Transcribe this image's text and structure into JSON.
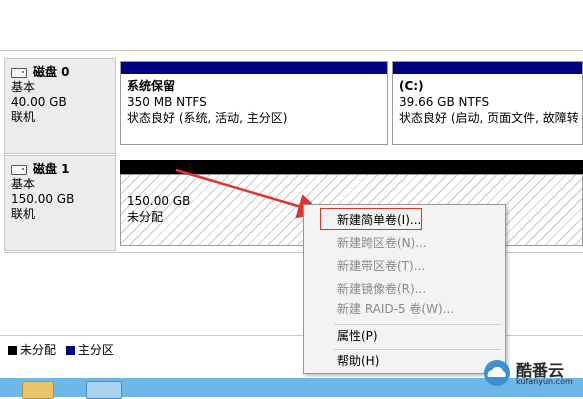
{
  "disks": [
    {
      "name": "磁盘 0",
      "type": "基本",
      "size": "40.00 GB",
      "status": "联机",
      "partitions": [
        {
          "name": "系统保留",
          "size": "350 MB NTFS",
          "status": "状态良好 (系统, 活动, 主分区)"
        },
        {
          "name": "(C:)",
          "size": "39.66 GB NTFS",
          "status": "状态良好 (启动, 页面文件, 故障转"
        }
      ]
    },
    {
      "name": "磁盘 1",
      "type": "基本",
      "size": "150.00 GB",
      "status": "联机",
      "partitions": [
        {
          "size": "150.00 GB",
          "status": "未分配"
        }
      ]
    }
  ],
  "legend": [
    {
      "label": "未分配",
      "color": "#000000"
    },
    {
      "label": "主分区",
      "color": "#000080"
    }
  ],
  "context_menu": {
    "items": [
      {
        "label": "新建简单卷(I)...",
        "enabled": true
      },
      {
        "label": "新建跨区卷(N)...",
        "enabled": false
      },
      {
        "label": "新建带区卷(T)...",
        "enabled": false
      },
      {
        "label": "新建镜像卷(R)...",
        "enabled": false
      },
      {
        "label": "新建 RAID-5 卷(W)...",
        "enabled": false
      },
      {
        "label": "属性(P)",
        "enabled": true
      },
      {
        "label": "帮助(H)",
        "enabled": true
      }
    ]
  },
  "colors": {
    "primary_partition": "#000080",
    "unallocated": "#000000",
    "annotation_red": "#e2342f",
    "taskbar": "#6db8e8"
  },
  "watermark": {
    "brand": "酷番云",
    "url": "kufanyun.com"
  },
  "icons": {
    "disk": "disk-drive-icon",
    "taskbar_folder": "folder-icon",
    "taskbar_app": "computer-management-icon"
  }
}
